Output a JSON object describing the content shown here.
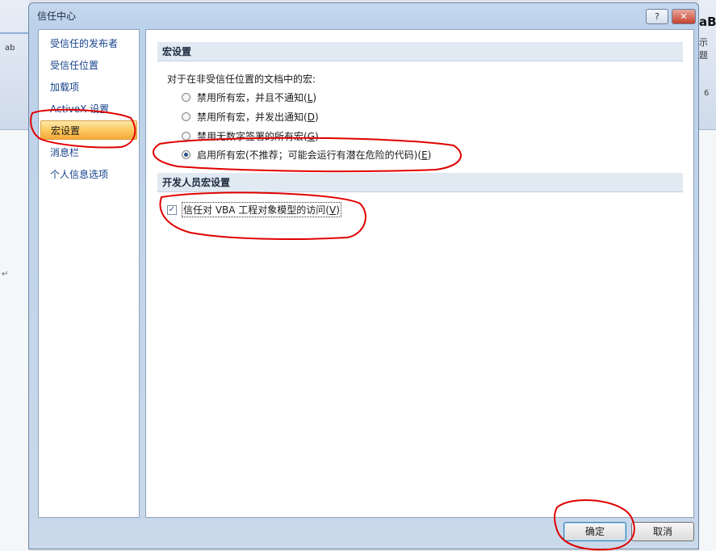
{
  "background": {
    "left_glyph": "ab",
    "right_text_1": "aB",
    "right_text_2": "示题",
    "right_text_3": "6",
    "return_mark": "↵"
  },
  "dialog": {
    "title": "信任中心",
    "help_label": "?",
    "close_label": "✕"
  },
  "nav": {
    "items": [
      {
        "label": "受信任的发布者"
      },
      {
        "label": "受信任位置"
      },
      {
        "label": "加载项"
      },
      {
        "label": "ActiveX 设置"
      },
      {
        "label": "宏设置"
      },
      {
        "label": "消息栏"
      },
      {
        "label": "个人信息选项"
      }
    ],
    "selected": "宏设置"
  },
  "macro": {
    "heading": "宏设置",
    "intro": "对于在非受信任位置的文档中的宏:",
    "options": [
      {
        "label": "禁用所有宏，并且不通知(",
        "key": "L",
        "suffix": ")",
        "selected": false
      },
      {
        "label": "禁用所有宏，并发出通知(",
        "key": "D",
        "suffix": ")",
        "selected": false
      },
      {
        "label": "禁用无数字签署的所有宏(",
        "key": "G",
        "suffix": ")",
        "selected": false
      },
      {
        "label": "启用所有宏(不推荐；可能会运行有潜在危险的代码)(",
        "key": "E",
        "suffix": ")",
        "selected": true
      }
    ]
  },
  "developer": {
    "heading": "开发人员宏设置",
    "vba_label": "信任对 VBA 工程对象模型的访问(",
    "vba_key": "V",
    "vba_suffix": ")",
    "vba_check_mark": "✓",
    "vba_checked": true
  },
  "buttons": {
    "ok": "确定",
    "cancel": "取消"
  },
  "annotation_color": "#e00000"
}
